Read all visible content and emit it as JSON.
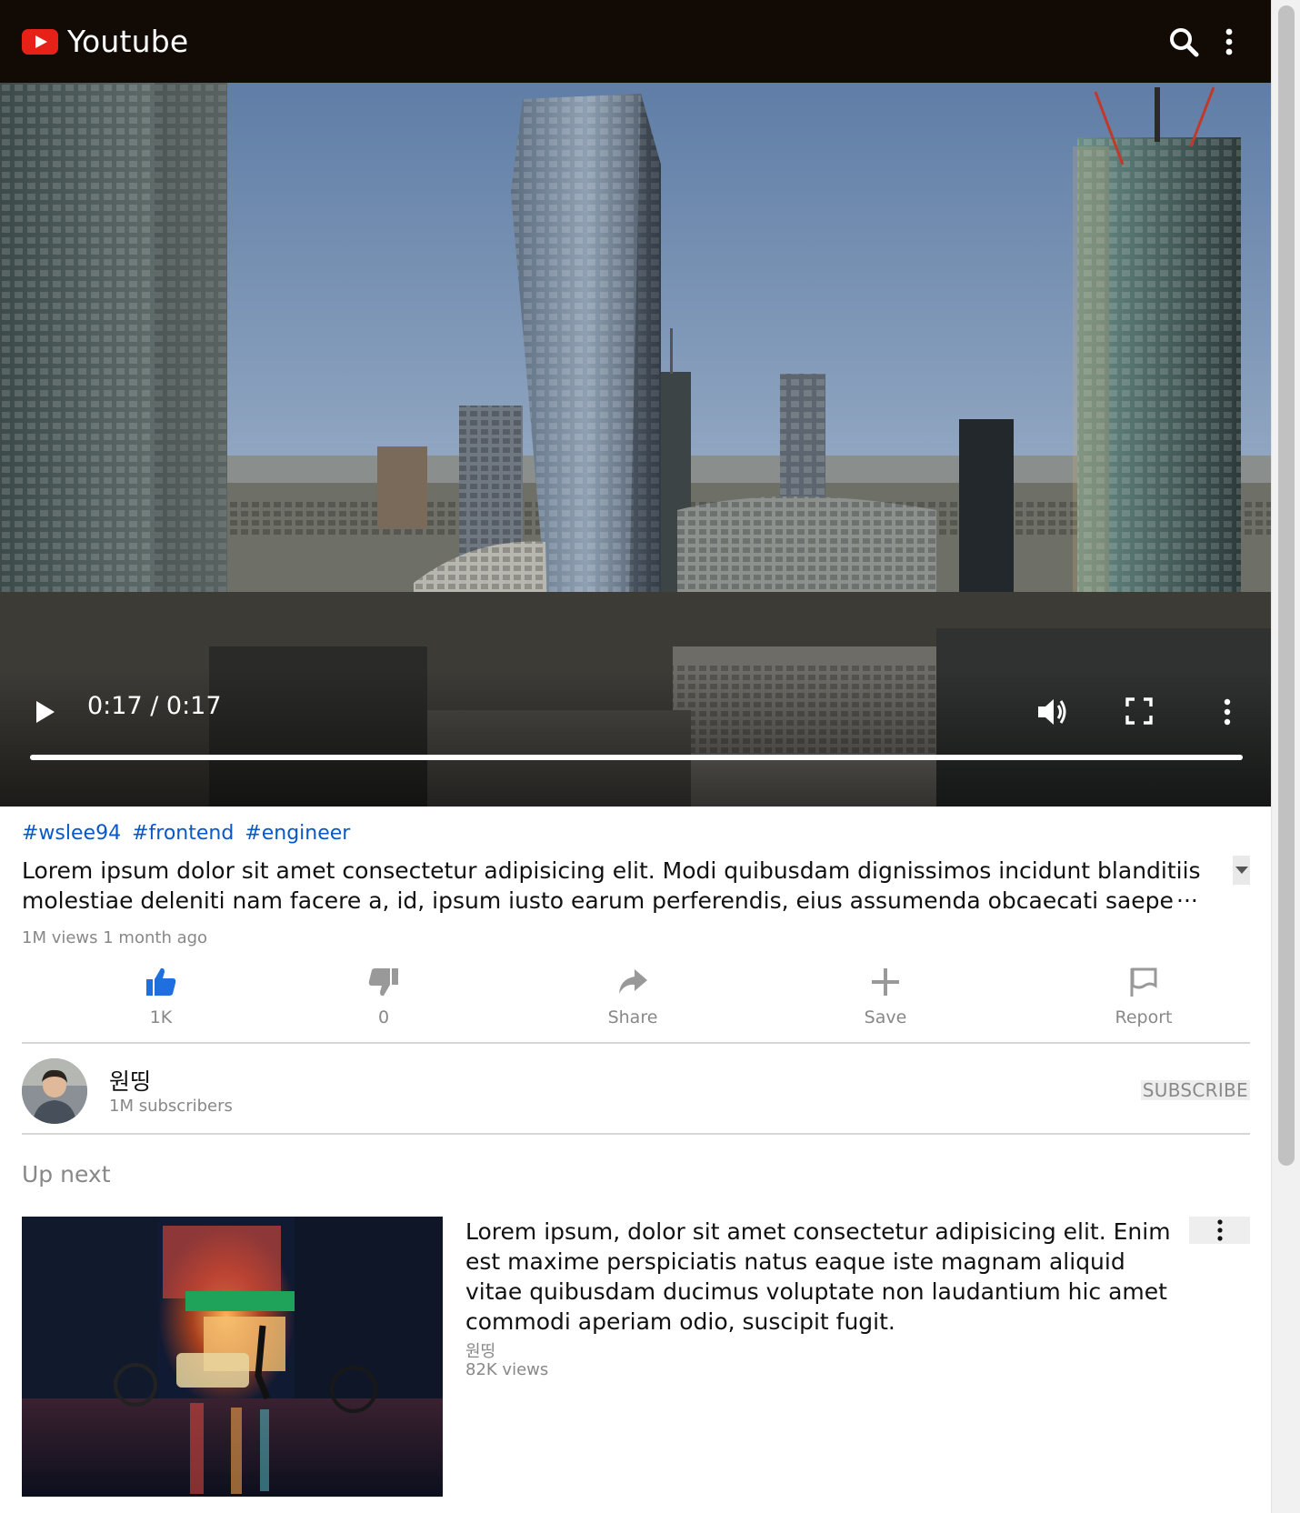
{
  "app": {
    "title": "Youtube"
  },
  "player": {
    "time_display": "0:17 / 0:17",
    "progress_percent": 100
  },
  "video": {
    "tags": [
      "#wslee94",
      "#frontend",
      "#engineer"
    ],
    "description": "Lorem ipsum dolor sit amet consectetur adipisicing elit. Modi quibusdam dignissimos incidunt blanditiis molestiae deleniti nam facere a, id, ipsum iusto earum perferendis, eius assumenda obcaecati saepe dolorem.",
    "ellipsis": "···",
    "meta": "1M views 1 month ago"
  },
  "actions": {
    "like": "1K",
    "dislike": "0",
    "share": "Share",
    "save": "Save",
    "report": "Report"
  },
  "channel": {
    "name": "원띵",
    "subscribers": "1M subscribers",
    "subscribe_label": "SUBSCRIBE"
  },
  "up_next": {
    "heading": "Up next",
    "items": [
      {
        "title": "Lorem ipsum, dolor sit amet consectetur adipisicing elit. Enim est maxime perspiciatis natus eaque iste magnam aliquid vitae quibusdam ducimus voluptate non laudantium hic amet commodi aperiam odio, suscipit fugit.",
        "channel": "원띵",
        "views": "82K views"
      }
    ]
  },
  "colors": {
    "header_bg": "#120b05",
    "brand_red": "#e62117",
    "like_active": "#1f6fe0",
    "tag_link": "#0a57c7",
    "muted_text": "#888888"
  },
  "icons": {
    "logo": "youtube-play-logo",
    "search": "search-icon",
    "menu": "vertical-dots-icon",
    "play": "play-icon",
    "volume": "volume-icon",
    "fullscreen": "fullscreen-icon",
    "like": "thumbs-up-icon",
    "dislike": "thumbs-down-icon",
    "share": "share-arrow-icon",
    "save": "plus-icon",
    "report": "flag-icon",
    "expand": "caret-down-icon"
  }
}
